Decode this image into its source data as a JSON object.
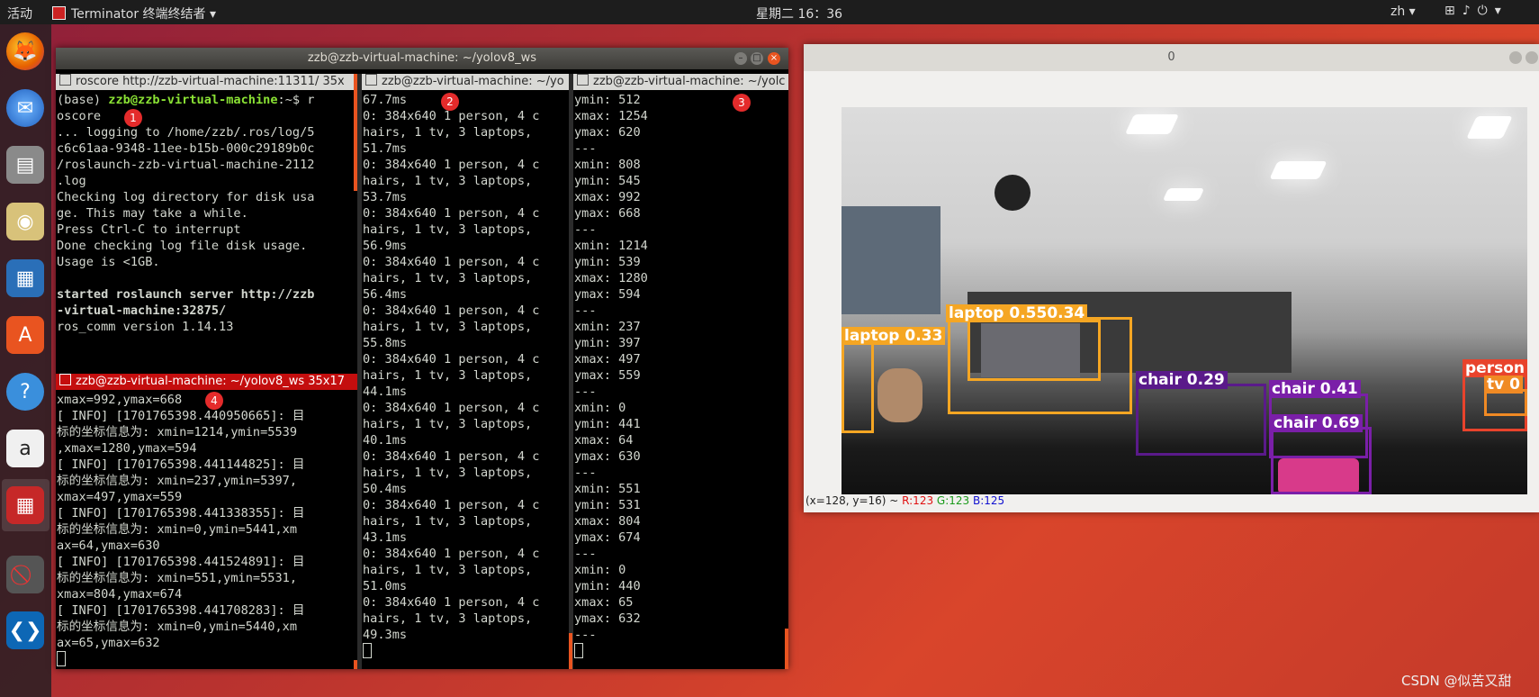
{
  "topbar": {
    "activities": "活动",
    "app_name": "Terminator 终端终结者",
    "clock": "星期二 16：36",
    "lang": "zh"
  },
  "terminal_window": {
    "title": "zzb@zzb-virtual-machine: ~/yolov8_ws",
    "pane1": {
      "title": "roscore http://zzb-virtual-machine:11311/ 35x",
      "lines": [
        "... logging to /home/zzb/.ros/log/5",
        "c6c61aa-9348-11ee-b15b-000c29189b0c",
        "/roslaunch-zzb-virtual-machine-2112",
        ".log",
        "Checking log directory for disk usa",
        "ge. This may take a while.",
        "Press Ctrl-C to interrupt",
        "Done checking log file disk usage.",
        "Usage is <1GB.",
        "",
        "started roslaunch server http://zzb",
        "-virtual-machine:32875/",
        "ros_comm version 1.14.13"
      ],
      "prompt_env": "(base) ",
      "prompt_user": "zzb@zzb-virtual-machine",
      "prompt_tail": ":~$ r",
      "prompt_cmd2": "oscore",
      "badge": "1"
    },
    "pane2": {
      "title": "zzb@zzb-virtual-machine: ~/yo",
      "text": "67.7ms\n0: 384x640 1 person, 4 c\nhairs, 1 tv, 3 laptops,\n51.7ms\n0: 384x640 1 person, 4 c\nhairs, 1 tv, 3 laptops,\n53.7ms\n0: 384x640 1 person, 4 c\nhairs, 1 tv, 3 laptops,\n56.9ms\n0: 384x640 1 person, 4 c\nhairs, 1 tv, 3 laptops,\n56.4ms\n0: 384x640 1 person, 4 c\nhairs, 1 tv, 3 laptops,\n55.8ms\n0: 384x640 1 person, 4 c\nhairs, 1 tv, 3 laptops,\n44.1ms\n0: 384x640 1 person, 4 c\nhairs, 1 tv, 3 laptops,\n40.1ms\n0: 384x640 1 person, 4 c\nhairs, 1 tv, 3 laptops,\n50.4ms\n0: 384x640 1 person, 4 c\nhairs, 1 tv, 3 laptops,\n43.1ms\n0: 384x640 1 person, 4 c\nhairs, 1 tv, 3 laptops,\n51.0ms\n0: 384x640 1 person, 4 c\nhairs, 1 tv, 3 laptops,\n49.3ms",
      "badge": "2"
    },
    "pane3": {
      "title": "zzb@zzb-virtual-machine: ~/yolc",
      "text": "ymin: 512\nxmax: 1254\nymax: 620\n---\nxmin: 808\nymin: 545\nxmax: 992\nymax: 668\n---\nxmin: 1214\nymin: 539\nxmax: 1280\nymax: 594\n---\nxmin: 237\nymin: 397\nxmax: 497\nymax: 559\n---\nxmin: 0\nymin: 441\nxmax: 64\nymax: 630\n---\nxmin: 551\nymin: 531\nxmax: 804\nymax: 674\n---\nxmin: 0\nymin: 440\nxmax: 65\nymax: 632\n---",
      "badge": "3"
    },
    "pane4": {
      "title": "zzb@zzb-virtual-machine: ~/yolov8_ws 35x17",
      "text": "xmax=992,ymax=668\n[ INFO] [1701765398.440950665]: 目\n标的坐标信息为: xmin=1214,ymin=5539\n,xmax=1280,ymax=594\n[ INFO] [1701765398.441144825]: 目\n标的坐标信息为: xmin=237,ymin=5397,\nxmax=497,ymax=559\n[ INFO] [1701765398.441338355]: 目\n标的坐标信息为: xmin=0,ymin=5441,xm\nax=64,ymax=630\n[ INFO] [1701765398.441524891]: 目\n标的坐标信息为: xmin=551,ymin=5531,\nxmax=804,ymax=674\n[ INFO] [1701765398.441708283]: 目\n标的坐标信息为: xmin=0,ymin=5440,xm\nax=65,ymax=632",
      "badge": "4"
    }
  },
  "image_window": {
    "title": "0",
    "status_prefix": "(x=128, y=16) ~ ",
    "status_r": "R:123",
    "status_g": "G:123",
    "status_b": "B:125",
    "colors": {
      "laptop": "#f5a623",
      "chair": "#5a1a8a",
      "chair2": "#7a1fa8",
      "person": "#e8432c",
      "tv": "#f08a24"
    },
    "detections": [
      {
        "label": "laptop 0.55",
        "score": "0.34"
      },
      {
        "label": "laptop 0.33"
      },
      {
        "label": "chair 0.29"
      },
      {
        "label": "chair 0.41"
      },
      {
        "label": "chair 0.69"
      },
      {
        "label": "person"
      },
      {
        "label": "tv 0"
      }
    ]
  },
  "watermark": "CSDN @似苦又甜"
}
